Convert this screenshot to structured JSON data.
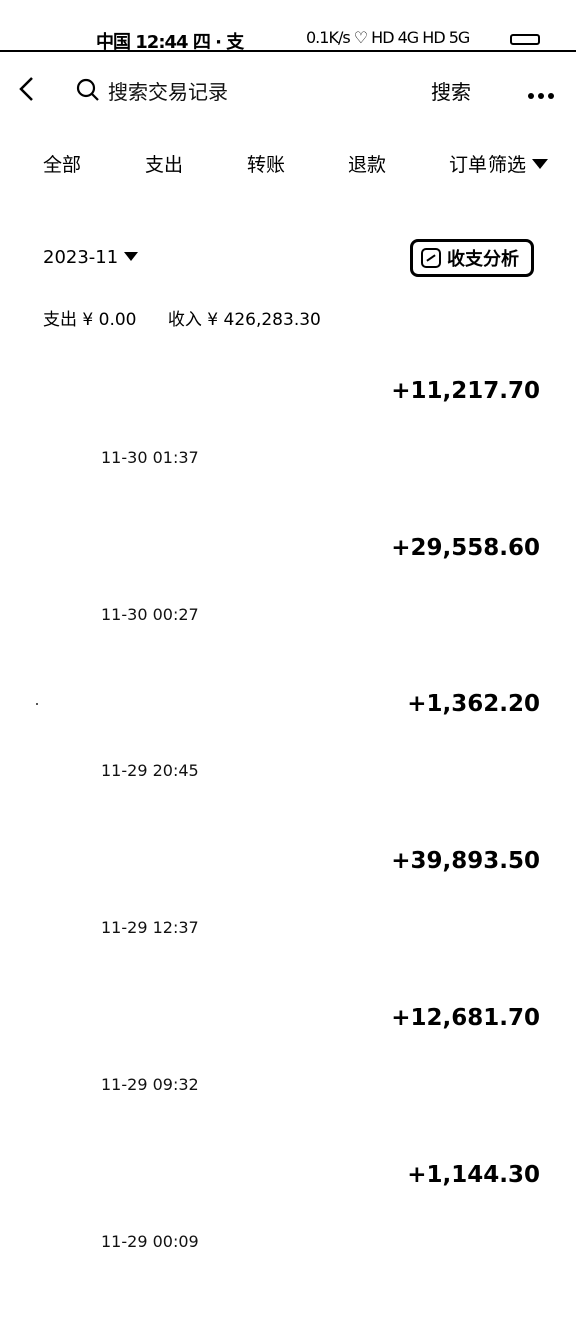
{
  "status_bar": {
    "left_text": "中国 12:44 四 · 支",
    "right_text": "0.1K/s ♡ HD 4G HD 5G"
  },
  "header": {
    "search_placeholder": "搜索交易记录",
    "search_button": "搜索"
  },
  "tabs": [
    {
      "label": "全部"
    },
    {
      "label": "支出"
    },
    {
      "label": "转账"
    },
    {
      "label": "退款"
    },
    {
      "label": "订单"
    }
  ],
  "filter_label": "筛选",
  "month_label": "2023-11",
  "analysis_label": "收支分析",
  "summary": {
    "expense": "支出 ¥ 0.00",
    "income": "收入 ¥ 426,283.30"
  },
  "records": [
    {
      "amount": "+11,217.70",
      "time": "11-30 01:37"
    },
    {
      "amount": "+29,558.60",
      "time": "11-30 00:27"
    },
    {
      "amount": "+1,362.20",
      "time": "11-29 20:45"
    },
    {
      "amount": "+39,893.50",
      "time": "11-29 12:37"
    },
    {
      "amount": "+12,681.70",
      "time": "11-29 09:32"
    },
    {
      "amount": "+1,144.30",
      "time": "11-29 00:09"
    }
  ]
}
